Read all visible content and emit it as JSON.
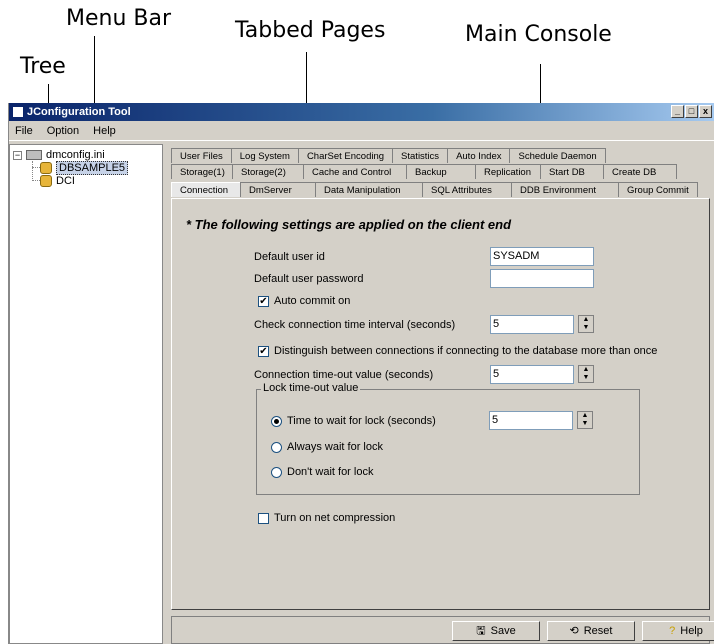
{
  "annotations": {
    "menu_bar": "Menu Bar",
    "tabbed_pages": "Tabbed Pages",
    "main_console": "Main Console",
    "tree": "Tree"
  },
  "window": {
    "title": "JConfiguration Tool",
    "buttons": [
      "_",
      "□",
      "x"
    ]
  },
  "menu": [
    "File",
    "Option",
    "Help"
  ],
  "tree": {
    "root": "dmconfig.ini",
    "children": [
      "DBSAMPLE5",
      "DCI"
    ]
  },
  "tabs": {
    "row1": [
      "User Files",
      "Log System",
      "CharSet Encoding",
      "Statistics",
      "Auto Index",
      "Schedule Daemon"
    ],
    "row2": [
      "Storage(1)",
      "Storage(2)",
      "Cache and Control",
      "Backup",
      "Replication",
      "Start DB",
      "Create DB"
    ],
    "row3": [
      "Connection",
      "DmServer",
      "Data Manipulation",
      "SQL Attributes",
      "DDB Environment",
      "Group Commit"
    ]
  },
  "panel": {
    "title": "* The following settings are applied on the client end",
    "default_user_label": "Default user id",
    "default_user_value": "SYSADM",
    "default_password_label": "Default user password",
    "default_password_value": "",
    "auto_commit_label": "Auto commit on",
    "check_conn_label": "Check connection time interval (seconds)",
    "check_conn_value": "5",
    "distinguish_label": "Distinguish between connections if connecting to the database more than once",
    "timeout_label": "Connection time-out value (seconds)",
    "timeout_value": "5",
    "lock_group_label": "Lock time-out value",
    "lock_wait_label": "Time to wait for lock (seconds)",
    "lock_wait_value": "5",
    "always_wait_label": "Always wait for lock",
    "dont_wait_label": "Don't wait for lock",
    "net_compression_label": "Turn on net compression"
  },
  "buttons": {
    "save": "Save",
    "reset": "Reset",
    "help": "Help"
  }
}
